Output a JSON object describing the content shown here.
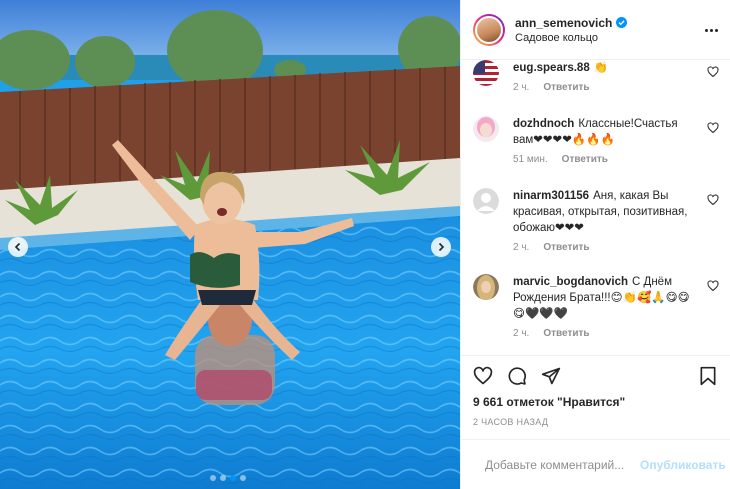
{
  "post": {
    "author": "ann_semenovich",
    "location": "Садовое кольцо",
    "likes_text": "9 661 отметок \"Нравится\"",
    "time_text": "2 ЧАСОВ НАЗАД"
  },
  "comments": [
    {
      "user": "eug.spears.88",
      "text": "👏",
      "time": "2 ч.",
      "reply": "Ответить",
      "avatar": "flag-usa"
    },
    {
      "user": "dozhdnoch",
      "text": "Классные!Счастья вам❤❤❤❤🔥🔥🔥",
      "time": "51 мин.",
      "reply": "Ответить",
      "avatar": "pink-hair-girl"
    },
    {
      "user": "ninarm301156",
      "text": "Аня, какая Вы красивая, открытая, позитивная, обожаю❤❤❤",
      "time": "2 ч.",
      "reply": "Ответить",
      "avatar": "default-user"
    },
    {
      "user": "marvic_bogdanovich",
      "text": "С Днём Рождения Брата!!!😊👏🥰🙏😋😋😋🖤🖤🖤",
      "time": "2 ч.",
      "reply": "Ответить",
      "avatar": "blonde-woman"
    }
  ],
  "comment_box": {
    "placeholder": "Добавьте комментарий...",
    "publish_label": "Опубликовать"
  },
  "icons": {
    "like": "heart-icon",
    "comment": "comment-icon",
    "share": "share-icon",
    "save": "bookmark-icon",
    "emoji": "emoji-icon",
    "more": "more-icon",
    "verified": "verified-badge-icon"
  },
  "colors": {
    "accent": "#0095f6",
    "publish_disabled": "#b2dffc",
    "muted": "#8e8e8e",
    "text": "#262626"
  }
}
